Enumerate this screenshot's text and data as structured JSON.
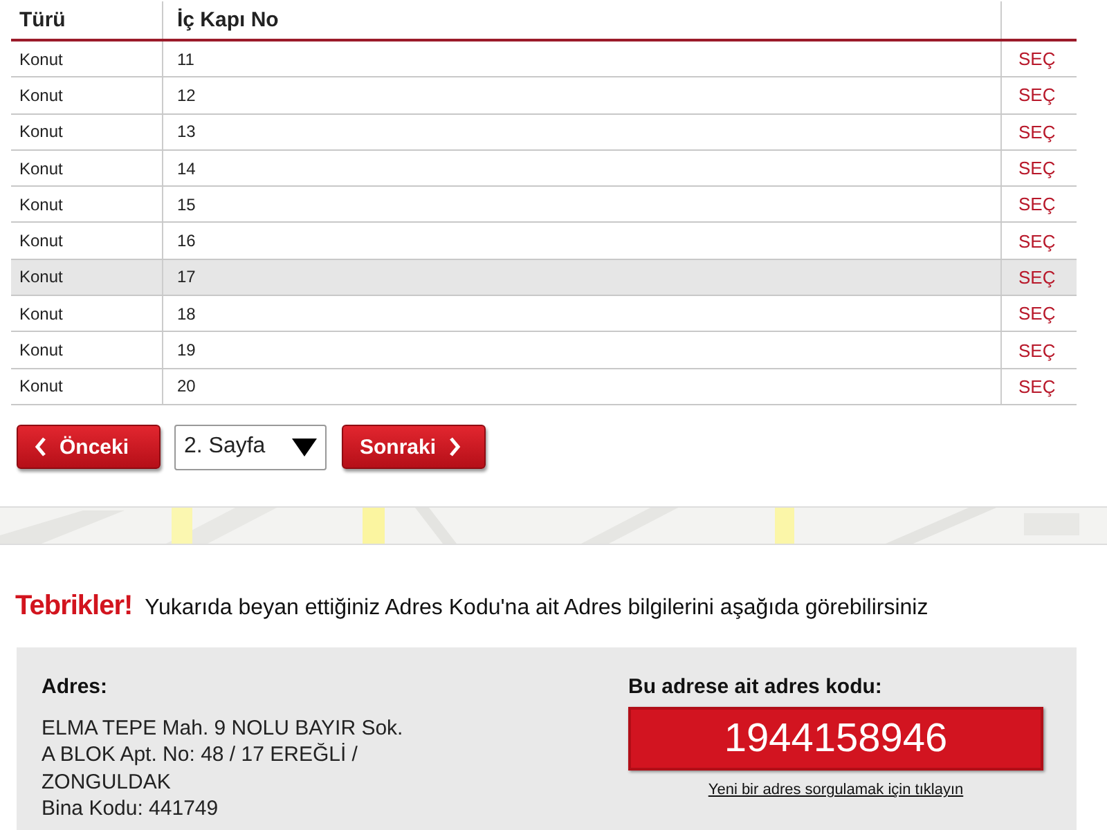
{
  "table": {
    "columns": [
      "Türü",
      "İç Kapı No"
    ],
    "rows": [
      {
        "type": "Konut",
        "number": "11",
        "action": "SEÇ",
        "selected": false
      },
      {
        "type": "Konut",
        "number": "12",
        "action": "SEÇ",
        "selected": false
      },
      {
        "type": "Konut",
        "number": "13",
        "action": "SEÇ",
        "selected": false
      },
      {
        "type": "Konut",
        "number": "14",
        "action": "SEÇ",
        "selected": false
      },
      {
        "type": "Konut",
        "number": "15",
        "action": "SEÇ",
        "selected": false
      },
      {
        "type": "Konut",
        "number": "16",
        "action": "SEÇ",
        "selected": false
      },
      {
        "type": "Konut",
        "number": "17",
        "action": "SEÇ",
        "selected": true
      },
      {
        "type": "Konut",
        "number": "18",
        "action": "SEÇ",
        "selected": false
      },
      {
        "type": "Konut",
        "number": "19",
        "action": "SEÇ",
        "selected": false
      },
      {
        "type": "Konut",
        "number": "20",
        "action": "SEÇ",
        "selected": false
      }
    ]
  },
  "pagination": {
    "previous": "Önceki",
    "page": "2. Sayfa",
    "next": "Sonraki"
  },
  "result": {
    "heading": "Tebrikler!",
    "message": "Yukarıda beyan ettiğiniz Adres Kodu'na ait Adres bilgilerini aşağıda görebilirsiniz"
  },
  "address": {
    "label": "Adres:",
    "lines": [
      "ELMA TEPE Mah. 9 NOLU BAYIR Sok.",
      "A BLOK Apt. No: 48 / 17 EREĞLİ /",
      "ZONGULDAK",
      "Bina Kodu: 441749"
    ]
  },
  "code": {
    "label": "Bu adrese ait adres kodu:",
    "value": "1944158946",
    "link": "Yeni bir adres sorgulamak için tıklayın"
  }
}
